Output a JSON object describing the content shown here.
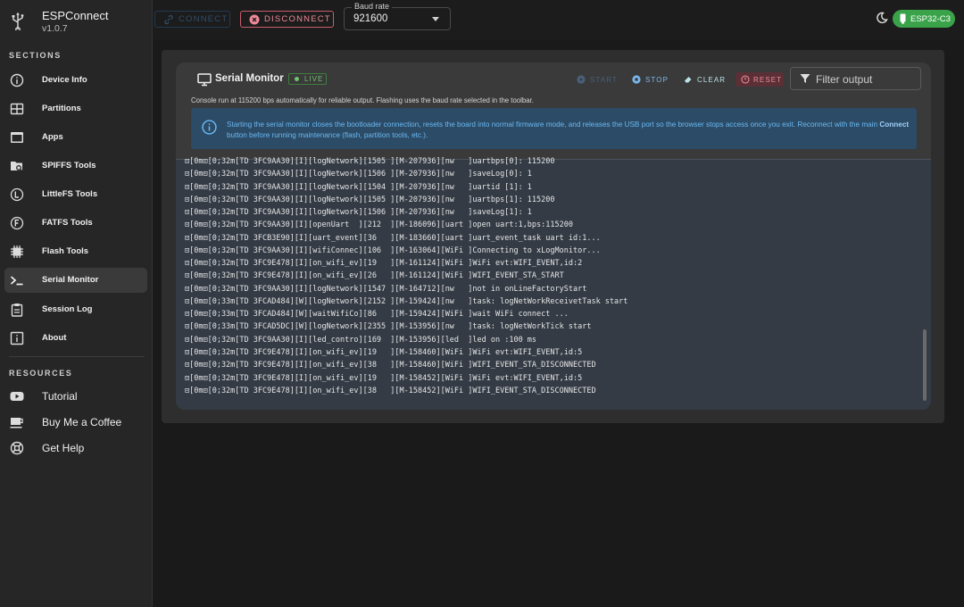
{
  "app": {
    "name": "ESPConnect",
    "version": "v1.0.7"
  },
  "sidebar": {
    "sections_title": "SECTIONS",
    "items": [
      {
        "label": "Device Info",
        "icon": "info-circle-icon"
      },
      {
        "label": "Partitions",
        "icon": "table-icon"
      },
      {
        "label": "Apps",
        "icon": "apps-window-icon"
      },
      {
        "label": "SPIFFS Tools",
        "icon": "folder-search-icon"
      },
      {
        "label": "LittleFS Tools",
        "icon": "littlefs-icon"
      },
      {
        "label": "FATFS Tools",
        "icon": "fatfs-icon"
      },
      {
        "label": "Flash Tools",
        "icon": "chip-icon"
      },
      {
        "label": "Serial Monitor",
        "icon": "terminal-icon",
        "active": true
      },
      {
        "label": "Session Log",
        "icon": "clipboard-icon"
      },
      {
        "label": "About",
        "icon": "info-square-icon"
      }
    ],
    "resources_title": "RESOURCES",
    "resources": [
      {
        "label": "Tutorial",
        "icon": "youtube-icon"
      },
      {
        "label": "Buy Me a Coffee",
        "icon": "coffee-icon"
      },
      {
        "label": "Get Help",
        "icon": "lifebuoy-icon"
      }
    ]
  },
  "toolbar": {
    "connect_label": "CONNECT",
    "disconnect_label": "DISCONNECT",
    "baud": {
      "label": "Baud rate",
      "value": "921600"
    },
    "chip_label": "ESP32-C3"
  },
  "serial_monitor": {
    "title": "Serial Monitor",
    "live_label": "LIVE",
    "start_label": "START",
    "stop_label": "STOP",
    "clear_label": "CLEAR",
    "reset_label": "RESET",
    "filter_placeholder": "Filter output",
    "note": "Console run at 115200 bps automatically for reliable output. Flashing uses the baud rate selected in the toolbar.",
    "info_part1": "Starting the serial monitor closes the bootloader connection, resets the board into normal firmware mode, and releases the USB port so the browser stops access once you exit. Reconnect with the main ",
    "info_bold": "Connect",
    "info_part2": " button before running maintenance (flash, partition tools, etc.).",
    "console_lines": [
      "⊡[0m⊡[0;32m[TD 3FC9AA30][I][logNetwork][1505 ][M-207936][nw   ]uartbps[0]: 115200",
      "⊡[0m⊡[0;32m[TD 3FC9AA30][I][logNetwork][1506 ][M-207936][nw   ]saveLog[0]: 1",
      "⊡[0m⊡[0;32m[TD 3FC9AA30][I][logNetwork][1504 ][M-207936][nw   ]uartid [1]: 1",
      "⊡[0m⊡[0;32m[TD 3FC9AA30][I][logNetwork][1505 ][M-207936][nw   ]uartbps[1]: 115200",
      "⊡[0m⊡[0;32m[TD 3FC9AA30][I][logNetwork][1506 ][M-207936][nw   ]saveLog[1]: 1",
      "⊡[0m⊡[0;32m[TD 3FC9AA30][I][openUart  ][212  ][M-186096][uart ]open uart:1,bps:115200",
      "⊡[0m⊡[0;32m[TD 3FCB3E90][I][uart_event][36   ][M-183660][uart ]uart_event_task uart id:1...",
      "⊡[0m⊡[0;32m[TD 3FC9AA30][I][wifiConnec][106  ][M-163064][WiFi ]Connecting to xLogMonitor...",
      "⊡[0m⊡[0;32m[TD 3FC9E478][I][on_wifi_ev][19   ][M-161124][WiFi ]WiFi evt:WIFI_EVENT,id:2",
      "⊡[0m⊡[0;32m[TD 3FC9E478][I][on_wifi_ev][26   ][M-161124][WiFi ]WIFI_EVENT_STA_START",
      "⊡[0m⊡[0;32m[TD 3FC9AA30][I][logNetwork][1547 ][M-164712][nw   ]not in onLineFactoryStart",
      "⊡[0m⊡[0;33m[TD 3FCAD484][W][logNetwork][2152 ][M-159424][nw   ]task: logNetWorkReceivetTask start",
      "⊡[0m⊡[0;33m[TD 3FCAD484][W][waitWifiCo][86   ][M-159424][WiFi ]wait WiFi connect ...",
      "⊡[0m⊡[0;33m[TD 3FCAD5DC][W][logNetwork][2355 ][M-153956][nw   ]task: logNetWorkTick start",
      "⊡[0m⊡[0;32m[TD 3FC9AA30][I][led_contro][169  ][M-153956][led  ]led on :100 ms",
      "⊡[0m⊡[0;32m[TD 3FC9E478][I][on_wifi_ev][19   ][M-158460][WiFi ]WiFi evt:WIFI_EVENT,id:5",
      "⊡[0m⊡[0;32m[TD 3FC9E478][I][on_wifi_ev][38   ][M-158460][WiFi ]WIFI_EVENT_STA_DISCONNECTED",
      "⊡[0m⊡[0;32m[TD 3FC9E478][I][on_wifi_ev][19   ][M-158452][WiFi ]WiFi evt:WIFI_EVENT,id:5",
      "⊡[0m⊡[0;32m[TD 3FC9E478][I][on_wifi_ev][38   ][M-158452][WiFi ]WIFI_EVENT_STA_DISCONNECTED"
    ]
  },
  "colors": {
    "accent_green": "#3aa34a",
    "danger": "#ee8a97",
    "info_blue": "#6cb9f3",
    "console_bg": "#343b45"
  }
}
